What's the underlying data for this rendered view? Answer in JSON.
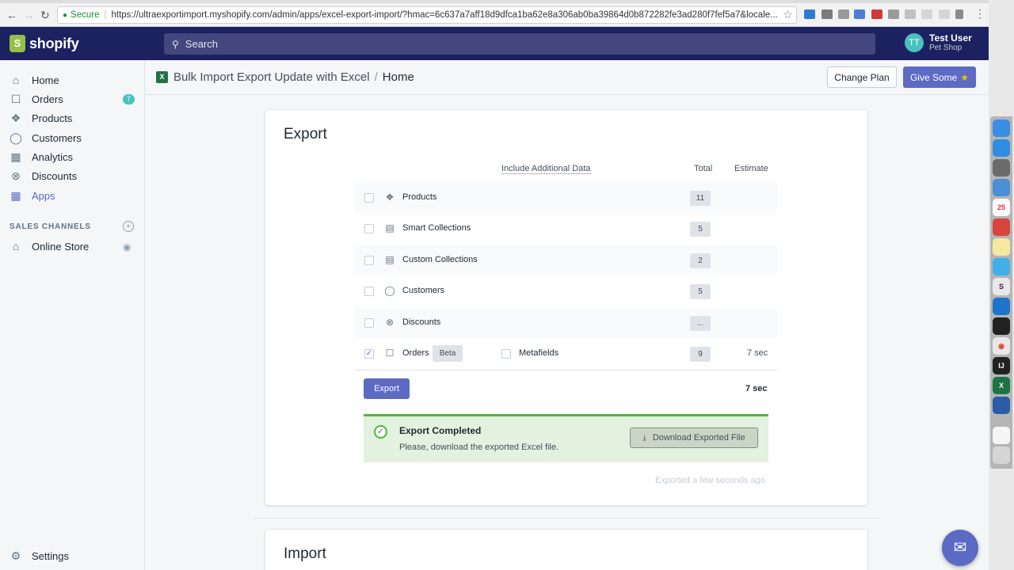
{
  "browser": {
    "secure_label": "Secure",
    "url": "https://ultraexportimport.myshopify.com/admin/apps/excel-export-import/?hmac=6c637a7aff18d9dfca1ba62e8a306ab0ba39864d0b872282fe3ad280f7fef5a7&locale..."
  },
  "topbar": {
    "brand": "shopify",
    "search_placeholder": "Search",
    "user_initials": "TT",
    "user_name": "Test User",
    "shop_name": "Pet Shop"
  },
  "sidebar": {
    "items": [
      {
        "label": "Home",
        "icon": "home-icon"
      },
      {
        "label": "Orders",
        "icon": "orders-icon",
        "badge": "7"
      },
      {
        "label": "Products",
        "icon": "tag-icon"
      },
      {
        "label": "Customers",
        "icon": "person-icon"
      },
      {
        "label": "Analytics",
        "icon": "bar-chart-icon"
      },
      {
        "label": "Discounts",
        "icon": "discount-icon"
      },
      {
        "label": "Apps",
        "icon": "apps-icon"
      }
    ],
    "channels_title": "SALES CHANNELS",
    "online_store": "Online Store",
    "settings": "Settings"
  },
  "header": {
    "app_name": "Bulk Import Export Update with Excel",
    "separator": "/",
    "current": "Home",
    "change_plan": "Change Plan",
    "give_some": "Give Some"
  },
  "export": {
    "title": "Export",
    "col_additional": "Include Additional Data",
    "col_total": "Total",
    "col_estimate": "Estimate",
    "rows": [
      {
        "label": "Products",
        "total": "11",
        "checked": false
      },
      {
        "label": "Smart Collections",
        "total": "5",
        "checked": false
      },
      {
        "label": "Custom Collections",
        "total": "2",
        "checked": false
      },
      {
        "label": "Customers",
        "total": "5",
        "checked": false
      },
      {
        "label": "Discounts",
        "total": "...",
        "checked": false
      },
      {
        "label": "Orders",
        "total": "9",
        "checked": true,
        "beta": "Beta",
        "extra": "Metafields",
        "estimate": "7 sec"
      }
    ],
    "export_button": "Export",
    "total_time": "7 sec",
    "banner_title": "Export Completed",
    "banner_body": "Please, download the exported Excel file.",
    "download_button": "Download Exported File",
    "exported_ago": "Exported a few seconds ago"
  },
  "import": {
    "title": "Import"
  },
  "colors": {
    "topbar": "#1c2260",
    "accent": "#5c6ac4",
    "success": "#50b83c",
    "banner_bg": "#e3f1df"
  }
}
